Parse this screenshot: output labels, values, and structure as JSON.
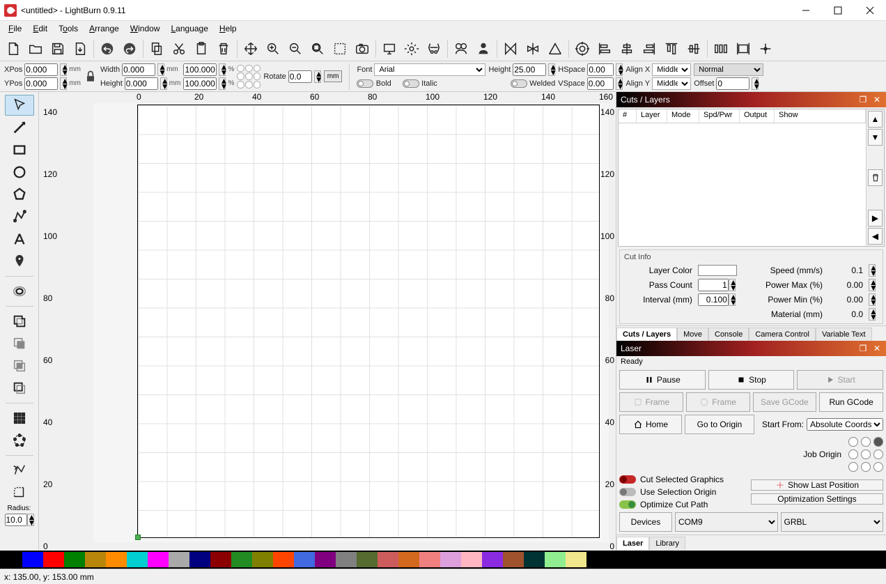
{
  "window": {
    "title": "<untitled> - LightBurn 0.9.11"
  },
  "menu": {
    "file": "File",
    "edit": "Edit",
    "tools": "Tools",
    "arrange": "Arrange",
    "window": "Window",
    "language": "Language",
    "help": "Help"
  },
  "props": {
    "xpos_label": "XPos",
    "xpos": "0.000",
    "ypos_label": "YPos",
    "ypos": "0.000",
    "width_label": "Width",
    "width": "0.000",
    "height_label": "Height",
    "height": "0.000",
    "scale_w": "100.000",
    "scale_h": "100.000",
    "rotate_label": "Rotate",
    "rotate": "0.0",
    "mm": "mm",
    "pct": "%",
    "mm_unit_btn": "mm",
    "font_label": "Font",
    "font": "Arial",
    "fheight_label": "Height",
    "fheight": "25.00",
    "hspace_label": "HSpace",
    "hspace": "0.00",
    "vspace_label": "VSpace",
    "vspace": "0.00",
    "alignx_label": "Align X",
    "alignx": "Middle",
    "aligny_label": "Align Y",
    "aligny": "Middle",
    "style": "Normal",
    "offset_label": "Offset",
    "offset": "0",
    "bold": "Bold",
    "italic": "Italic",
    "welded": "Welded"
  },
  "lefttools": {
    "radius_label": "Radius:",
    "radius": "10.0"
  },
  "ruler": {
    "ticks": [
      "0",
      "20",
      "40",
      "60",
      "80",
      "100",
      "120",
      "140",
      "160"
    ],
    "vticks": [
      "0",
      "20",
      "40",
      "60",
      "80",
      "100",
      "120",
      "140"
    ]
  },
  "cuts_panel": {
    "title": "Cuts / Layers",
    "headers": {
      "num": "#",
      "layer": "Layer",
      "mode": "Mode",
      "spdpwr": "Spd/Pwr",
      "output": "Output",
      "show": "Show"
    },
    "cutinfo_title": "Cut Info",
    "labels": {
      "layer_color": "Layer Color",
      "pass_count": "Pass Count",
      "interval": "Interval (mm)",
      "speed": "Speed (mm/s)",
      "power_max": "Power Max (%)",
      "power_min": "Power Min (%)",
      "material": "Material (mm)"
    },
    "values": {
      "pass_count": "1",
      "interval": "0.100",
      "speed": "0.1",
      "power_max": "0.00",
      "power_min": "0.00",
      "material": "0.0"
    },
    "tabs": {
      "cuts": "Cuts / Layers",
      "move": "Move",
      "console": "Console",
      "camera": "Camera Control",
      "vartext": "Variable Text"
    }
  },
  "laser_panel": {
    "title": "Laser",
    "status": "Ready",
    "btns": {
      "pause": "Pause",
      "stop": "Stop",
      "start": "Start",
      "frame1": "Frame",
      "frame2": "Frame",
      "save_gcode": "Save GCode",
      "run_gcode": "Run GCode",
      "home": "Home",
      "go_origin": "Go to Origin",
      "show_last": "Show Last Position",
      "opt_settings": "Optimization Settings",
      "devices": "Devices"
    },
    "labels": {
      "start_from": "Start From:",
      "job_origin": "Job Origin",
      "cut_sel": "Cut Selected Graphics",
      "use_sel": "Use Selection Origin",
      "opt_path": "Optimize Cut Path"
    },
    "start_from_val": "Absolute Coords",
    "port": "COM9",
    "device": "GRBL",
    "tabs": {
      "laser": "Laser",
      "library": "Library"
    }
  },
  "colors": [
    "#000000",
    "#0000ff",
    "#ff0000",
    "#008000",
    "#b8860b",
    "#ff8c00",
    "#00ced1",
    "#ff00ff",
    "#a9a9a9",
    "#000080",
    "#8b0000",
    "#228b22",
    "#808000",
    "#ff4500",
    "#4169e1",
    "#800080",
    "#808080",
    "#556b2f",
    "#cd5c5c",
    "#d2691e",
    "#f08080",
    "#dda0dd",
    "#ffb6c1",
    "#8a2be2",
    "#a0522d",
    "#003333",
    "#90ee90",
    "#f0e68c"
  ],
  "statusbar": {
    "coords": "x: 135.00, y: 153.00 mm"
  }
}
